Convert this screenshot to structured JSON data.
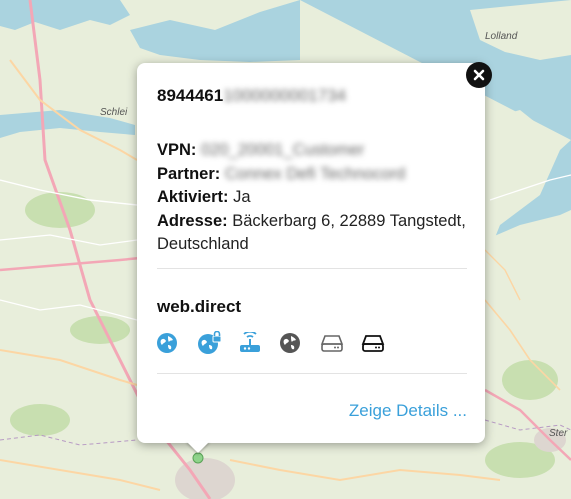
{
  "map": {
    "labels": {
      "lolland": "Lolland",
      "schlei": "Schlei",
      "ster": "Ster"
    },
    "colors": {
      "land": "#e8eedb",
      "water": "#aad3df",
      "forest": "#b9d8a3",
      "road_major": "#f3a7b6",
      "road_minor": "#fcd6a4",
      "urban": "#ddd6d0"
    }
  },
  "popup": {
    "iccid_prefix": "8944461",
    "iccid_redacted": "1000000001734",
    "vpn_label": "VPN:",
    "vpn_value": "020_20001_Customer",
    "partner_label": "Partner:",
    "partner_value": "Connex Defi Technocord",
    "activated_label": "Aktiviert:",
    "activated_value": "Ja",
    "address_label": "Adresse:",
    "address_value": "Bäckerbarg 6, 22889 Tangstedt, Deutschland",
    "apn": "web.direct",
    "service_icons": [
      "globe-icon",
      "globe-lock-icon",
      "router-icon",
      "globe-dark-icon",
      "drive-icon",
      "drive-dark-icon"
    ],
    "details_link": "Zeige Details ...",
    "accent_color": "#3aa0da"
  }
}
